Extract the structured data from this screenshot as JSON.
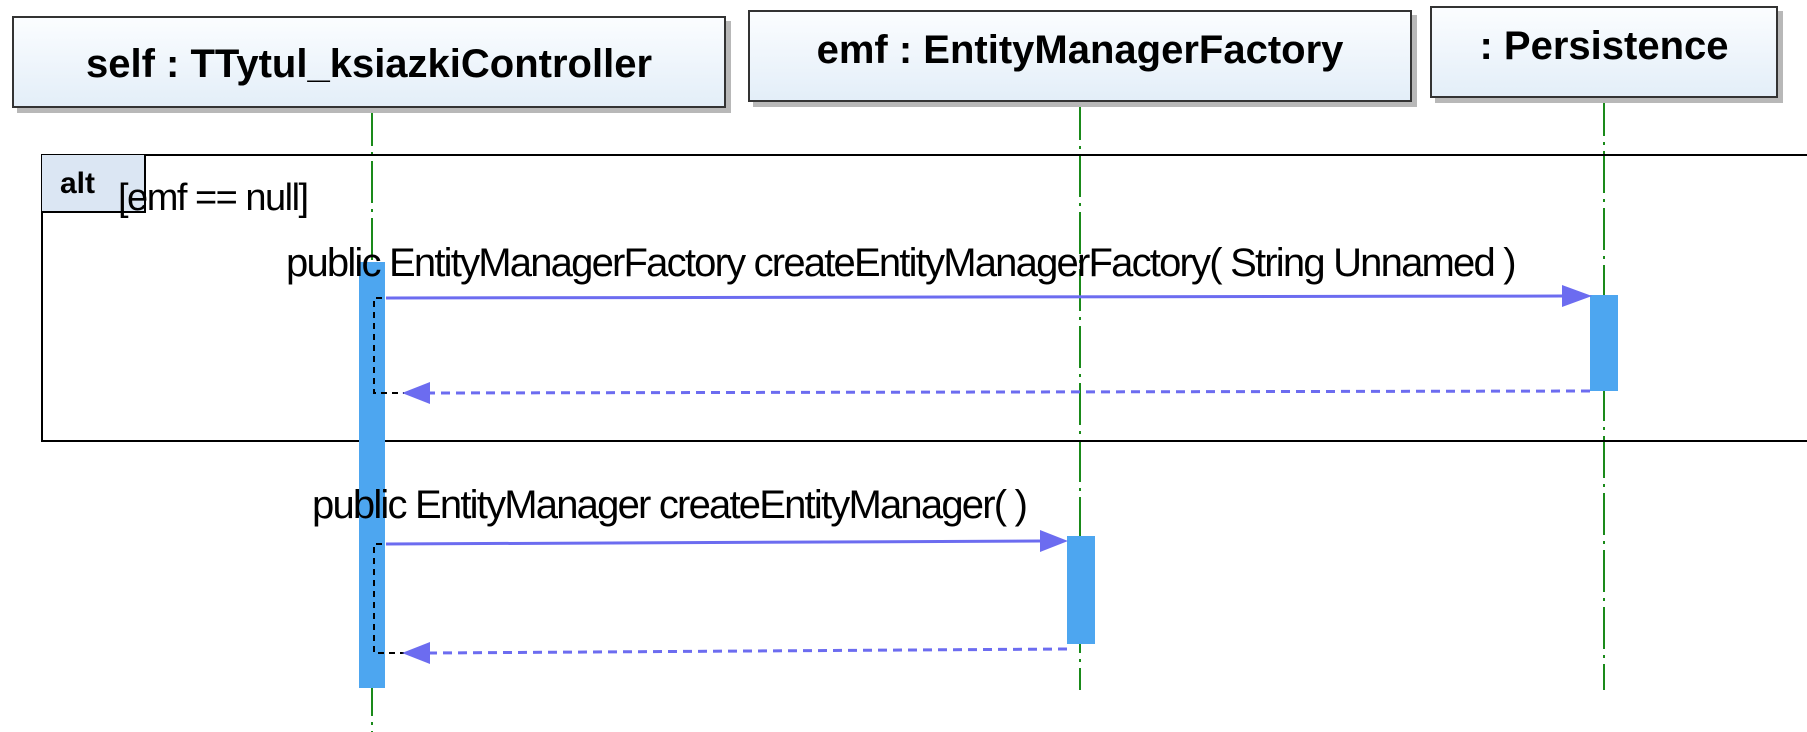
{
  "lifelines": [
    {
      "id": "controller",
      "label": "self : TTytul_ksiazkiController"
    },
    {
      "id": "emf",
      "label": "emf : EntityManagerFactory"
    },
    {
      "id": "persistence",
      "label": ": Persistence"
    }
  ],
  "fragment": {
    "operator": "alt",
    "guard": "[emf == null]"
  },
  "messages": [
    {
      "from": "controller",
      "to": "persistence",
      "label": "public EntityManagerFactory  createEntityManagerFactory( String Unnamed )"
    },
    {
      "from": "controller",
      "to": "emf",
      "label": "public EntityManager  createEntityManager(  )"
    }
  ],
  "colors": {
    "lifeline": "#1a8a1a",
    "activation": "#4da6f0",
    "message_arrow": "#6c6cf0",
    "frame_border": "#000000",
    "header_fill": "#e3eef8"
  }
}
